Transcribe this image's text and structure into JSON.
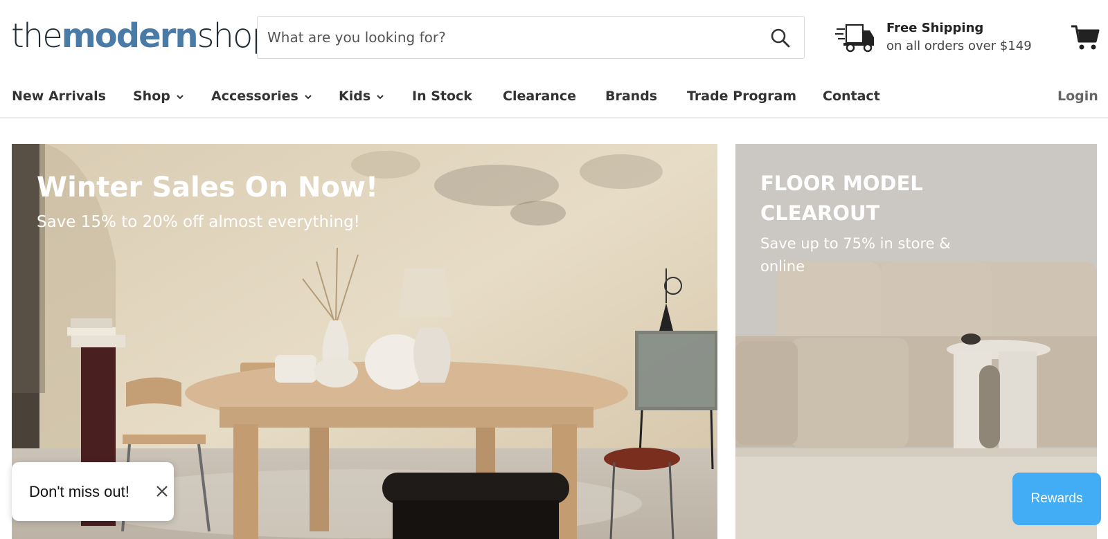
{
  "header": {
    "logo": {
      "part1": "the",
      "part2": "modern",
      "part3": "shop"
    },
    "search": {
      "placeholder": "What are you looking for?",
      "value": ""
    },
    "shipping": {
      "title": "Free Shipping",
      "subtitle": "on all orders over $149"
    }
  },
  "nav": {
    "items": [
      {
        "label": "New Arrivals",
        "dropdown": false
      },
      {
        "label": "Shop",
        "dropdown": true
      },
      {
        "label": "Accessories",
        "dropdown": true
      },
      {
        "label": "Kids",
        "dropdown": true
      },
      {
        "label": "In Stock",
        "dropdown": false
      },
      {
        "label": "Clearance",
        "dropdown": false
      },
      {
        "label": "Brands",
        "dropdown": false
      },
      {
        "label": "Trade Program",
        "dropdown": false
      },
      {
        "label": "Contact",
        "dropdown": false
      }
    ],
    "login": "Login"
  },
  "hero_left": {
    "title": "Winter Sales On Now!",
    "subtitle": "Save 15% to 20% off almost everything!"
  },
  "hero_right": {
    "title_line1": "FLOOR MODEL",
    "title_line2": "CLEAROUT",
    "subtitle_line1": "Save up to 75% in store &",
    "subtitle_line2": "online"
  },
  "popup": {
    "label": "Don't miss out!"
  },
  "rewards": {
    "label": "Rewards"
  },
  "colors": {
    "brand_blue": "#4a7aa6",
    "rewards_blue": "#42adf4"
  }
}
